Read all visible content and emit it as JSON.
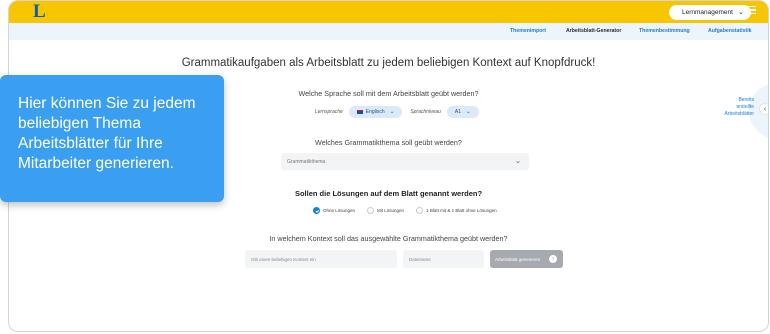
{
  "header": {
    "logo": "L",
    "lernmanagement_label": "Lernmanagement"
  },
  "subnav": {
    "items": [
      "Themenimport",
      "Arbeitsblatt-Generator",
      "Themenbestimmung",
      "Aufgabenstatistik"
    ],
    "active": "Arbeitsblatt-Generator"
  },
  "main": {
    "headline": "Grammatikaufgaben als Arbeitsblatt zu jedem beliebigen Kontext auf Knopfdruck!",
    "question_language": "Welche Sprache soll mit dem Arbeitsblatt geübt werden?",
    "lernsprache_label": "Lernsprache",
    "lernsprache_value": "Englisch",
    "sprachniveau_label": "Sprachniveau",
    "sprachniveau_value": "A1",
    "question_topic": "Welches Grammatikthema soll geübt werden?",
    "topic_placeholder": "Grammatikthema",
    "question_solutions": "Sollen die Lösungen auf dem Blatt genannt werden?",
    "solution_options": [
      "Ohne Lösungen",
      "Mit Lösungen",
      "1 Blatt mit & 1 Blatt ohne Lösungen"
    ],
    "solution_selected": "Ohne Lösungen",
    "question_context": "In welchem Kontext soll das ausgewählte Grammatikthema geübt werden?",
    "context_placeholder": "Gib einen beliebigen Kontext ein",
    "filename_placeholder": "Dateiname",
    "generate_button": "Arbeitsblatt generieren"
  },
  "side_panel": {
    "line1": "Bereits",
    "line2": "erstellte",
    "line3": "Arbeitsblätter"
  },
  "tooltip": {
    "text": "Hier können Sie zu jedem beliebigen Thema Arbeitsblätter für Ihre Mitarbeiter generieren."
  },
  "colors": {
    "brand_yellow": "#f7c600",
    "brand_blue": "#1a7fd0",
    "tooltip_blue": "#3a9ff0"
  }
}
